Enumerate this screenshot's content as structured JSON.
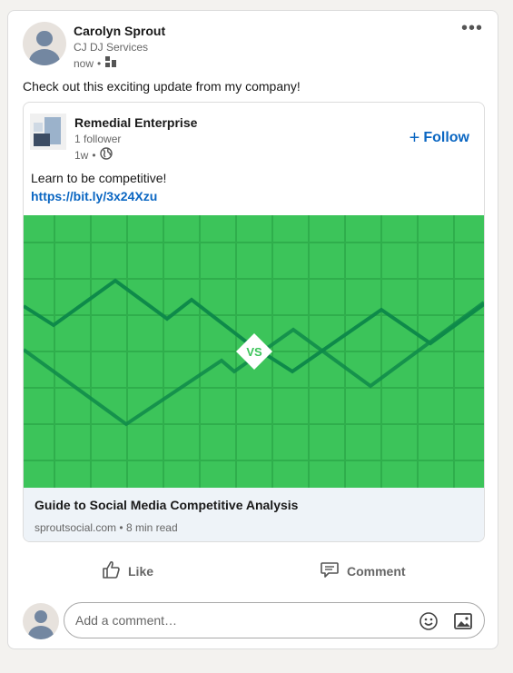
{
  "post": {
    "author_name": "Carolyn Sprout",
    "author_company": "CJ DJ Services",
    "timestamp": "now",
    "visibility_icon": "people-icon",
    "more_label": "•••",
    "text": "Check out this exciting update from my company!"
  },
  "shared": {
    "company_name": "Remedial Enterprise",
    "followers": "1 follower",
    "age": "1w",
    "visibility_icon": "globe-icon",
    "follow_label": "Follow",
    "text": "Learn to be competitive!",
    "link": "https://bit.ly/3x24Xzu",
    "hero_badge": "VS",
    "article_title": "Guide to Social Media Competitive Analysis",
    "article_source": "sproutsocial.com",
    "article_read_time": "8 min read"
  },
  "actions": {
    "like_label": "Like",
    "comment_label": "Comment"
  },
  "comment": {
    "placeholder": "Add a comment…"
  },
  "colors": {
    "link_blue": "#0a66c2",
    "hero_green": "#3cc45a",
    "hero_dark_line": "#0e8a4a"
  }
}
